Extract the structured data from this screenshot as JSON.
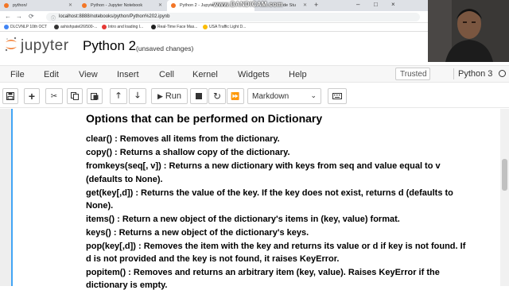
{
  "browser": {
    "tabs": [
      {
        "label": "python/",
        "active": false
      },
      {
        "label": "Python - Jupyter Notebook",
        "active": false
      },
      {
        "label": "Python 2 - Jupyter Noteb",
        "active": true
      },
      {
        "label": "de Stu",
        "active": false
      }
    ],
    "new_tab": "+",
    "overlay_watermark": "www.BANDICAM.com",
    "window_controls": [
      "–",
      "□",
      "×"
    ],
    "url": "localhost:8888/notebooks/python/Python%202.ipynb",
    "bookmarks": [
      {
        "label": "DLCVNLP 10th OCT",
        "color": "#4285f4"
      },
      {
        "label": "ashishpatel26/500-...",
        "color": "#333333"
      },
      {
        "label": "Intro and loading I...",
        "color": "#e53935"
      },
      {
        "label": "Real-Time Face Mas...",
        "color": "#212121"
      },
      {
        "label": "USA Traffic Light D...",
        "color": "#fbbc05"
      }
    ]
  },
  "jupyter": {
    "brand": "jupyter",
    "notebook_title": "Python 2",
    "save_status": "(unsaved changes)",
    "menu": [
      "File",
      "Edit",
      "View",
      "Insert",
      "Cell",
      "Kernel",
      "Widgets",
      "Help"
    ],
    "trusted": "Trusted",
    "kernel_name": "Python 3",
    "toolbar": {
      "run_label": "Run",
      "cell_type": "Markdown"
    }
  },
  "cell": {
    "heading": "Options that can be performed on Dictionary",
    "lines": [
      "clear() : Removes all items from the dictionary.",
      "copy() : Returns a shallow copy of the dictionary.",
      "fromkeys(seq[, v]) : Returns a new dictionary with keys from seq and value equal to v",
      "(defaults to None).",
      "get(key[,d]) : Returns the value of the key. If the key does not exist, returns d (defaults to",
      "None).",
      "items() : Return a new object of the dictionary's items in (key, value) format.",
      "keys() : Returns a new object of the dictionary's keys.",
      "pop(key[,d]) : Removes the item with the key and returns its value or d if key is not found. If",
      "d is not provided and the key is not found, it raises KeyError.",
      "popitem() : Removes and returns an arbitrary item (key, value). Raises KeyError if the",
      "dictionary is empty."
    ]
  },
  "colors": {
    "jupyter_orange": "#f37626",
    "cell_border": "#42a5f5",
    "notebook_bg": "#eeeeee"
  }
}
